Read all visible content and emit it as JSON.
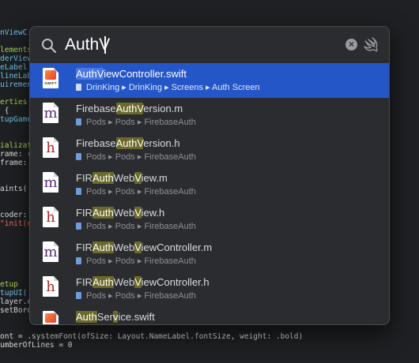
{
  "editor": {
    "lines": [
      {
        "text": "nViewC",
        "color": "#6fc6e8"
      },
      {
        "text": "",
        "color": "#dcdcdc"
      },
      {
        "text": "lements",
        "color": "#a5d94f"
      },
      {
        "text": "derView",
        "color": "#6fc6e8"
      },
      {
        "text": "eLabel",
        "color": "#6fc6e8"
      },
      {
        "text": "lineLab",
        "color": "#6fc6e8"
      },
      {
        "text": "uiremen",
        "color": "#6fc6e8"
      },
      {
        "text": "",
        "color": "#dcdcdc"
      },
      {
        "text": "erties",
        "color": "#a5d94f"
      },
      {
        "text": " {",
        "color": "#dcdcdc"
      },
      {
        "text": "tupGame",
        "color": "#6fc6e8"
      },
      {
        "text": "",
        "color": "#dcdcdc"
      },
      {
        "text": "",
        "color": "#dcdcdc"
      },
      {
        "text": "ializat",
        "color": "#a5d94f"
      },
      {
        "text": "rame: (",
        "color": "#dcdcdc"
      },
      {
        "text": "frame: ",
        "color": "#dcdcdc"
      },
      {
        "text": "",
        "color": "#dcdcdc"
      },
      {
        "text": "",
        "color": "#dcdcdc"
      },
      {
        "text": "aints(",
        "color": "#dcdcdc"
      },
      {
        "text": "",
        "color": "#dcdcdc"
      },
      {
        "text": "",
        "color": "#dcdcdc"
      },
      {
        "text": "coder: ",
        "color": "#dcdcdc"
      },
      {
        "text": "\"init(c",
        "color": "#fc6a5d"
      },
      {
        "text": "",
        "color": "#dcdcdc"
      },
      {
        "text": "",
        "color": "#dcdcdc"
      },
      {
        "text": "",
        "color": "#dcdcdc"
      },
      {
        "text": "",
        "color": "#dcdcdc"
      },
      {
        "text": "",
        "color": "#dcdcdc"
      },
      {
        "text": "",
        "color": "#dcdcdc"
      },
      {
        "text": "etup",
        "color": "#a5d94f"
      },
      {
        "text": "tupUI(",
        "color": "#6fc6e8"
      },
      {
        "text": "layer.c",
        "color": "#dcdcdc"
      },
      {
        "text": "setBord",
        "color": "#dcdcdc"
      },
      {
        "text": "",
        "color": "#dcdcdc"
      },
      {
        "text": "",
        "color": "#dcdcdc"
      },
      {
        "text": "ont = .systemFont(ofSize: Layout.NameLabel.fontSize, weight: .bold)",
        "color": "#dcdcdc"
      },
      {
        "text": "umberOfLines = 0",
        "color": "#dcdcdc"
      }
    ]
  },
  "search": {
    "query": "AuthV",
    "clear_icon": "clear-x-icon",
    "mode_icon": "swift-bird-icon"
  },
  "results": [
    {
      "icon": "swift",
      "name_parts": [
        {
          "t": "Auth",
          "h": true
        },
        {
          "t": "V",
          "h": true
        },
        {
          "t": "iewController.swift",
          "h": false
        }
      ],
      "path": [
        "DrinKing",
        "DrinKing",
        "Screens",
        "Auth Screen"
      ],
      "selected": true
    },
    {
      "icon": "m",
      "name_parts": [
        {
          "t": "Firebase",
          "h": false
        },
        {
          "t": "Auth",
          "h": true
        },
        {
          "t": "V",
          "h": true
        },
        {
          "t": "ersion.m",
          "h": false
        }
      ],
      "path": [
        "Pods",
        "Pods",
        "FirebaseAuth"
      ],
      "selected": false
    },
    {
      "icon": "h",
      "name_parts": [
        {
          "t": "Firebase",
          "h": false
        },
        {
          "t": "Auth",
          "h": true
        },
        {
          "t": "V",
          "h": true
        },
        {
          "t": "ersion.h",
          "h": false
        }
      ],
      "path": [
        "Pods",
        "Pods",
        "FirebaseAuth"
      ],
      "selected": false
    },
    {
      "icon": "m",
      "name_parts": [
        {
          "t": "FIR",
          "h": false
        },
        {
          "t": "Auth",
          "h": true
        },
        {
          "t": "Web",
          "h": false
        },
        {
          "t": "V",
          "h": true
        },
        {
          "t": "iew.m",
          "h": false
        }
      ],
      "path": [
        "Pods",
        "Pods",
        "FirebaseAuth"
      ],
      "selected": false
    },
    {
      "icon": "h",
      "name_parts": [
        {
          "t": "FIR",
          "h": false
        },
        {
          "t": "Auth",
          "h": true
        },
        {
          "t": "Web",
          "h": false
        },
        {
          "t": "V",
          "h": true
        },
        {
          "t": "iew.h",
          "h": false
        }
      ],
      "path": [
        "Pods",
        "Pods",
        "FirebaseAuth"
      ],
      "selected": false
    },
    {
      "icon": "m",
      "name_parts": [
        {
          "t": "FIR",
          "h": false
        },
        {
          "t": "Auth",
          "h": true
        },
        {
          "t": "Web",
          "h": false
        },
        {
          "t": "V",
          "h": true
        },
        {
          "t": "iewController.m",
          "h": false
        }
      ],
      "path": [
        "Pods",
        "Pods",
        "FirebaseAuth"
      ],
      "selected": false
    },
    {
      "icon": "h",
      "name_parts": [
        {
          "t": "FIR",
          "h": false
        },
        {
          "t": "Auth",
          "h": true
        },
        {
          "t": "Web",
          "h": false
        },
        {
          "t": "V",
          "h": true
        },
        {
          "t": "iewController.h",
          "h": false
        }
      ],
      "path": [
        "Pods",
        "Pods",
        "FirebaseAuth"
      ],
      "selected": false
    },
    {
      "icon": "swift",
      "name_parts": [
        {
          "t": "Auth",
          "h": true
        },
        {
          "t": "Ser",
          "h": false
        },
        {
          "t": "v",
          "h": true
        },
        {
          "t": "ice.swift",
          "h": false
        }
      ],
      "path": [],
      "selected": false
    }
  ],
  "colors": {
    "selection": "#2556c8",
    "match_highlight": "#6b6a2a"
  },
  "labels": {
    "path_separator": "▸",
    "swift_badge": "SWIFT"
  }
}
